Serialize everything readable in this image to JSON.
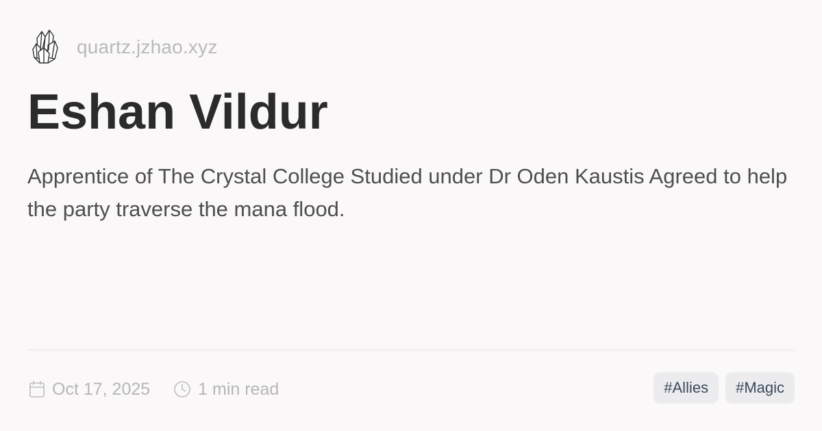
{
  "site": {
    "logo_icon": "crystal-cluster-icon",
    "url": "quartz.jzhao.xyz"
  },
  "page": {
    "title": "Eshan Vildur",
    "description": "Apprentice of The Crystal College Studied under Dr Oden Kaustis Agreed to help the party traverse the mana flood."
  },
  "meta": {
    "date_icon": "calendar-icon",
    "date": "Oct 17, 2025",
    "read_time_icon": "clock-icon",
    "read_time": "1 min read"
  },
  "tags": [
    "#Allies",
    "#Magic"
  ],
  "colors": {
    "background": "#faf8f8",
    "title": "#2b2b2b",
    "body_text": "#4e4e4e",
    "muted_text": "#b6b6ba",
    "tag_background": "#ececee",
    "tag_text": "#394a5c",
    "divider": "#e3e1e4"
  }
}
